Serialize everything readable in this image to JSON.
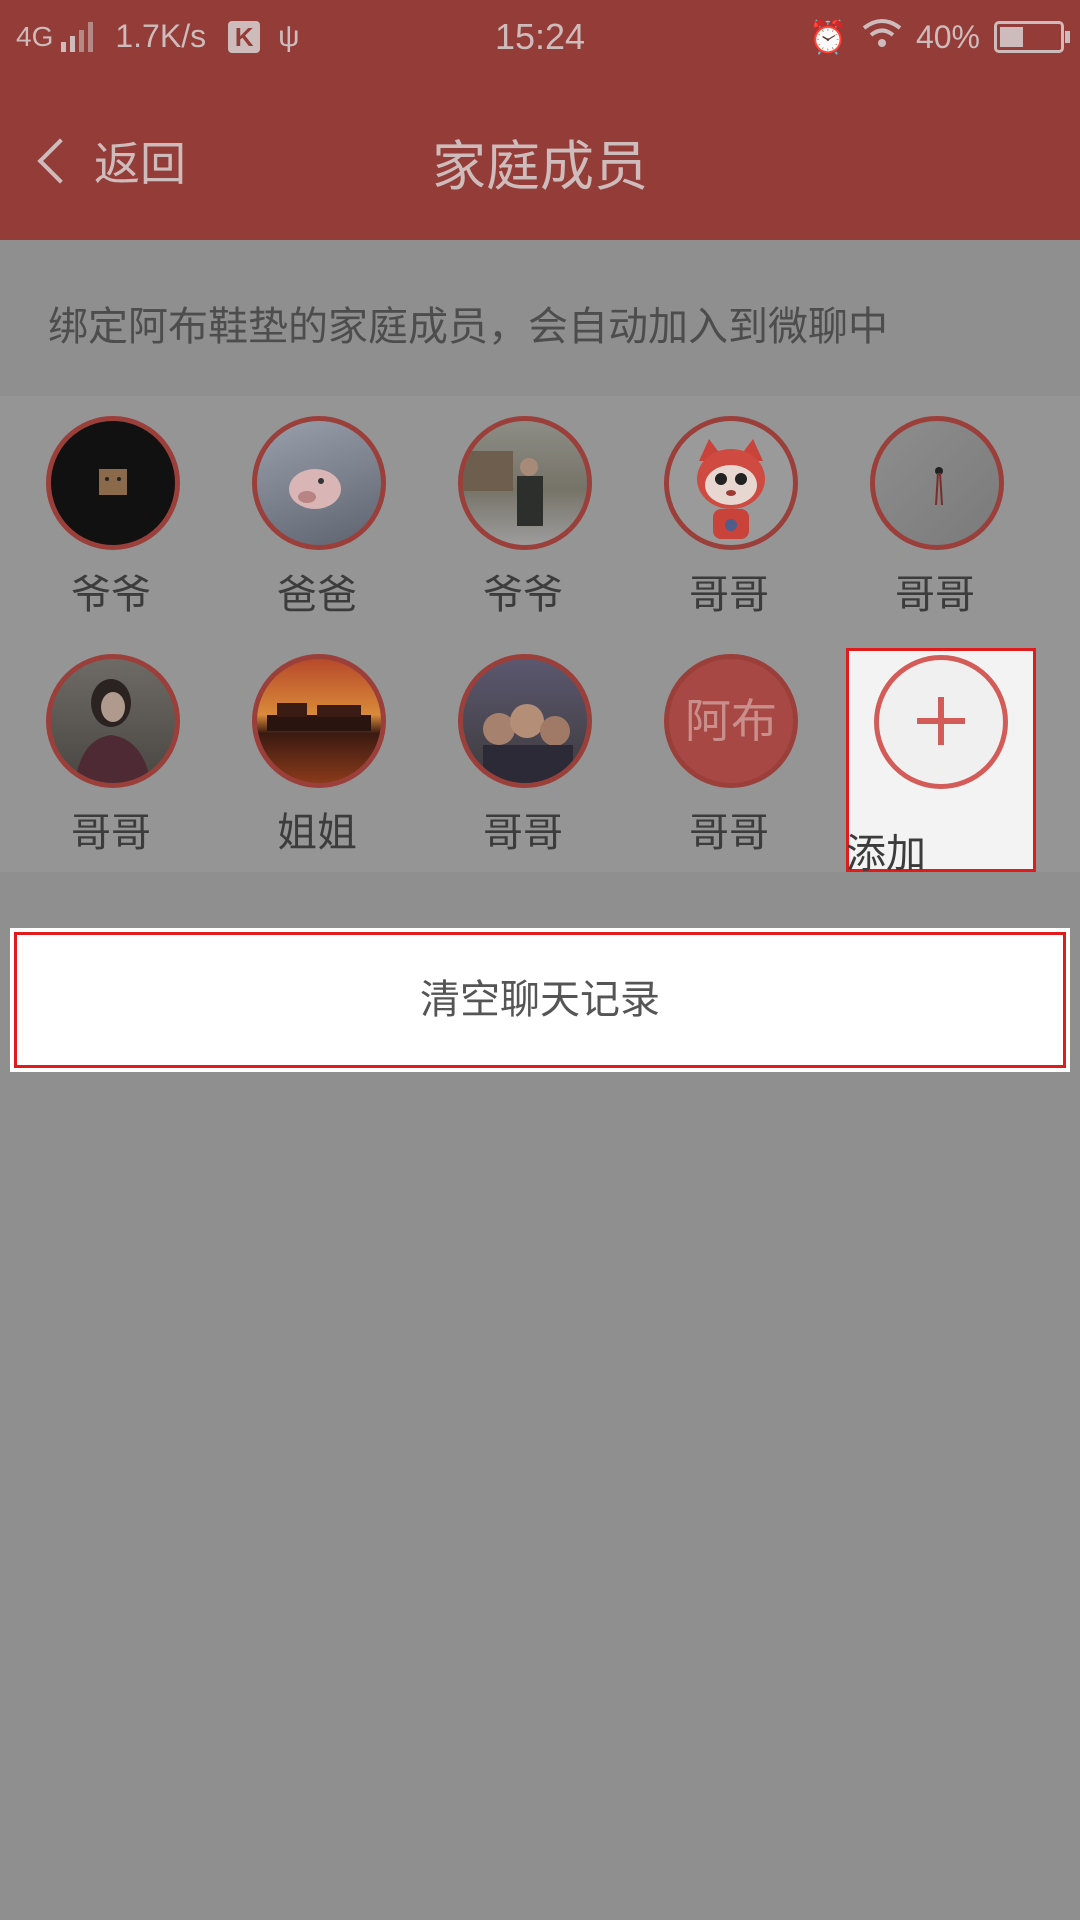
{
  "status_bar": {
    "network": "4G",
    "speed": "1.7K/s",
    "app_badge": "K",
    "time": "15:24",
    "battery": "40%",
    "battery_level": 0.4
  },
  "header": {
    "back_label": "返回",
    "title": "家庭成员"
  },
  "info_text": "绑定阿布鞋垫的家庭成员，会自动加入到微聊中",
  "members": [
    {
      "name": "爷爷",
      "avatar": "photo-cat"
    },
    {
      "name": "爸爸",
      "avatar": "photo-pig"
    },
    {
      "name": "爷爷",
      "avatar": "photo-man-outdoors"
    },
    {
      "name": "哥哥",
      "avatar": "cartoon-mascot"
    },
    {
      "name": "哥哥",
      "avatar": "photo-wall"
    },
    {
      "name": "哥哥",
      "avatar": "photo-woman"
    },
    {
      "name": "姐姐",
      "avatar": "photo-sunset-pier"
    },
    {
      "name": "哥哥",
      "avatar": "photo-kids"
    },
    {
      "name": "哥哥",
      "avatar_text": "阿布"
    }
  ],
  "add_label": "添加",
  "clear_button": "清空聊天记录",
  "colors": {
    "header": "#943c38",
    "accent": "#d45c58",
    "highlight": "#e01b1b"
  }
}
